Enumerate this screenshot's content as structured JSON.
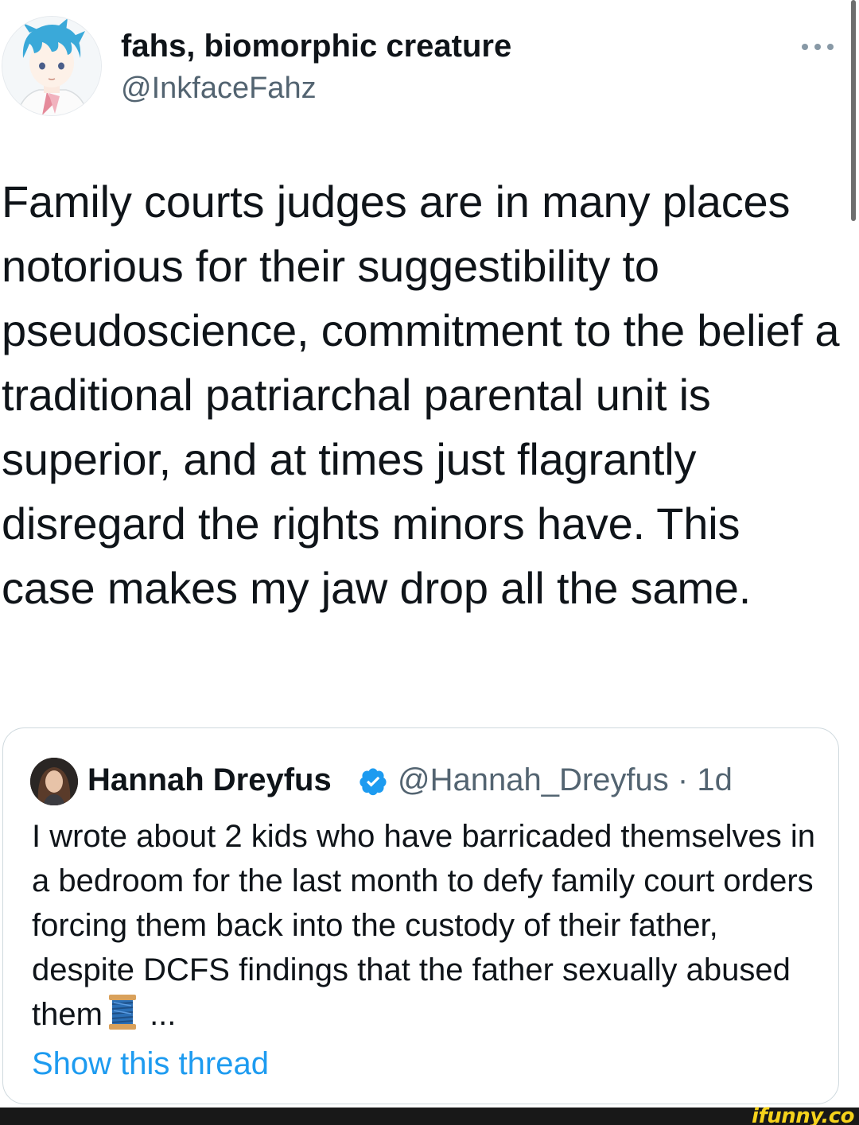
{
  "author": {
    "display_name": "fahs, biomorphic creature",
    "handle": "@InkfaceFahz",
    "avatar_icon": "anime-avatar-icon",
    "more_icon": "more-options-icon"
  },
  "tweet": {
    "text": "Family courts judges are in many places notorious for their suggestibility to pseudoscience, commitment to the belief a traditional patriarchal parental unit is superior, and at times just flagrantly disregard the rights minors have. This case makes my jaw drop all the same."
  },
  "quoted_tweet": {
    "display_name": "Hannah Dreyfus",
    "verified_icon": "verified-badge-icon",
    "handle_time": "@Hannah_Dreyfus · 1d",
    "text_main": "I wrote about 2 kids who have barricaded themselves in a bedroom for the last month to defy family court orders forcing them back into the custody of their father, despite DCFS findings that the father sexually abused them",
    "thread_emoji": "spool-of-thread-icon",
    "text_ellipsis": "...",
    "show_thread_label": "Show this thread"
  },
  "watermark": "ifunny.co",
  "colors": {
    "text_primary": "#0f1419",
    "text_secondary": "#536471",
    "link": "#1d9bf0",
    "verified": "#1d9bf0",
    "border": "#cfd9de",
    "watermark": "#f5d21b"
  }
}
